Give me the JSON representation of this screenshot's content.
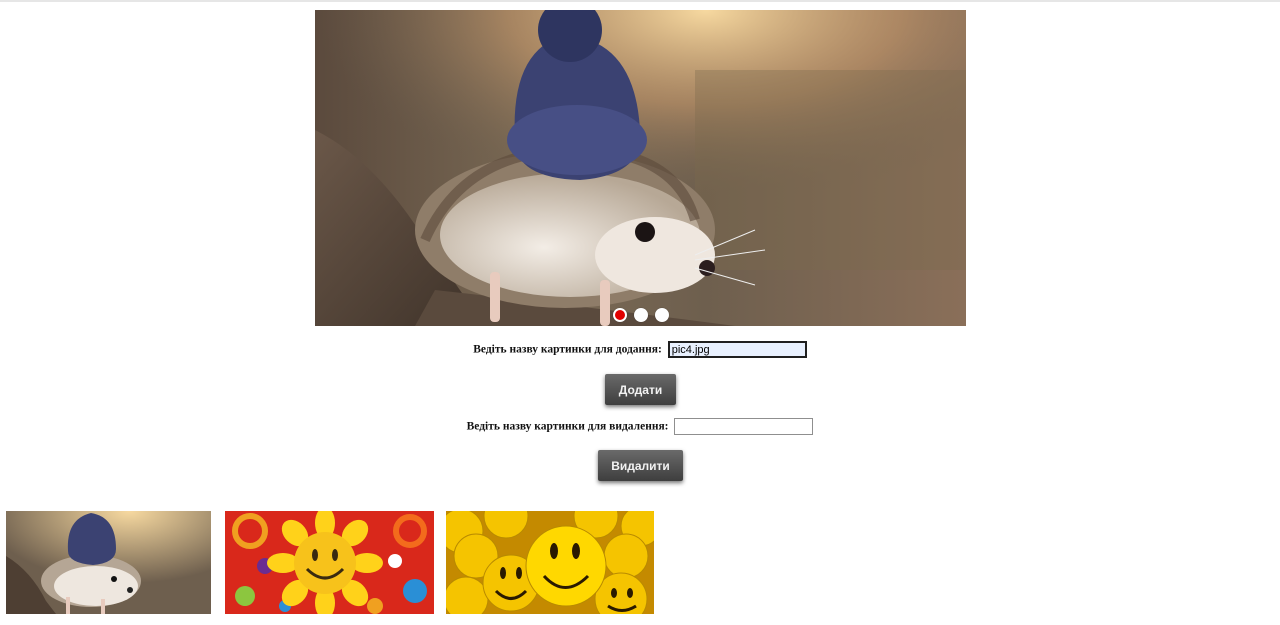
{
  "slider": {
    "images": [
      {
        "alt": "hedgehog-in-hat"
      },
      {
        "alt": "sunflower-smiley"
      },
      {
        "alt": "yellow-smiley-balls"
      }
    ],
    "active_index": 0,
    "dots_count": 3,
    "colors": {
      "active_dot": "#e10000",
      "dot": "#ffffff"
    }
  },
  "add_form": {
    "label": "Ведіть назву картинки для додання:",
    "value": "pic4.jpg",
    "button_label": "Додати"
  },
  "delete_form": {
    "label": "Ведіть назву картинки для видалення:",
    "value": "",
    "button_label": "Видалити"
  },
  "thumbnails": [
    {
      "alt": "hedgehog-in-hat"
    },
    {
      "alt": "sunflower-smiley"
    },
    {
      "alt": "yellow-smiley-balls"
    }
  ]
}
